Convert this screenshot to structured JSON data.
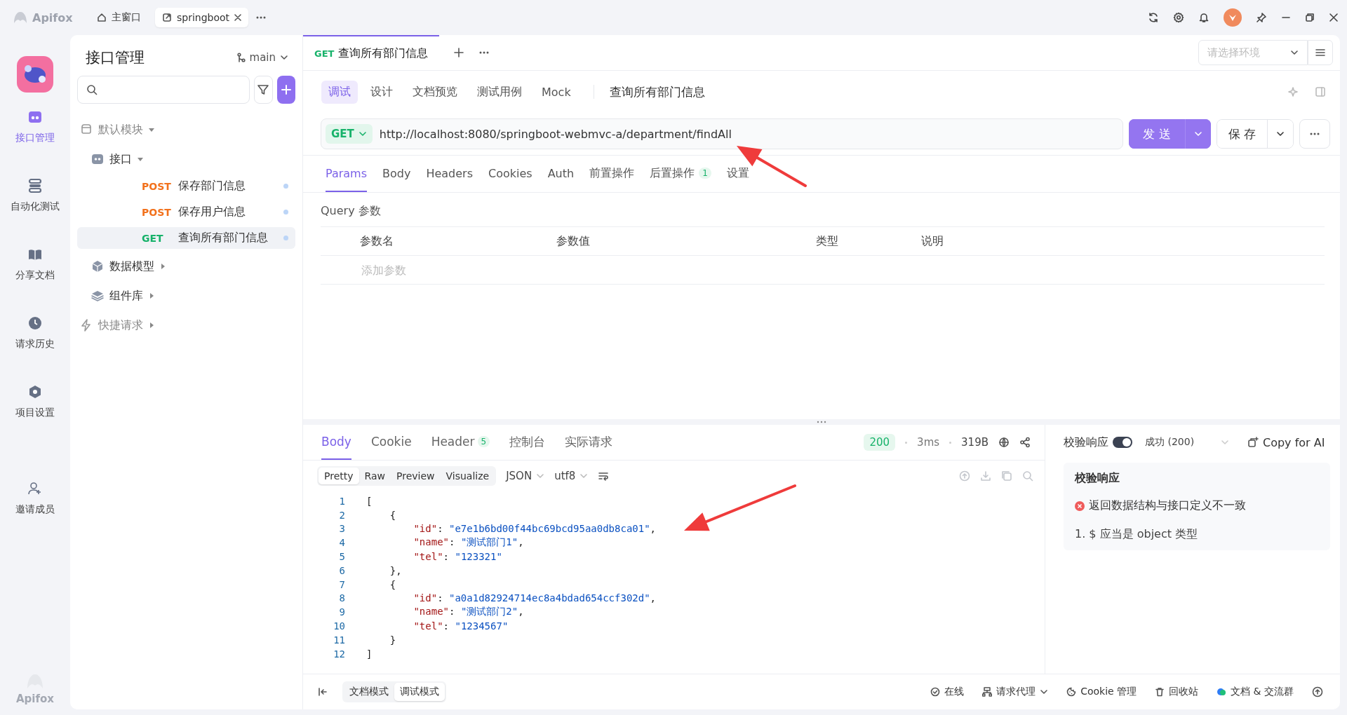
{
  "titlebar": {
    "app_name": "Apifox",
    "tabs": [
      {
        "label": "主窗口",
        "selected": false
      },
      {
        "label": "springboot",
        "selected": true
      }
    ]
  },
  "rail": {
    "items": [
      {
        "label": "接口管理",
        "selected": true
      },
      {
        "label": "自动化测试",
        "selected": false
      },
      {
        "label": "分享文档",
        "selected": false
      },
      {
        "label": "请求历史",
        "selected": false
      },
      {
        "label": "项目设置",
        "selected": false
      },
      {
        "label": "邀请成员",
        "selected": false
      }
    ],
    "footer_brand": "Apifox"
  },
  "tree_panel": {
    "title": "接口管理",
    "branch": "main",
    "items": [
      {
        "label": "默认模块",
        "kind": "module",
        "expanded": true,
        "children": [
          {
            "label": "接口",
            "kind": "folder",
            "expanded": true,
            "children": [
              {
                "kind": "endpoint",
                "method": "POST",
                "label": "保存部门信息",
                "selected": false
              },
              {
                "kind": "endpoint",
                "method": "POST",
                "label": "保存用户信息",
                "selected": false
              },
              {
                "kind": "endpoint",
                "method": "GET",
                "label": "查询所有部门信息",
                "selected": true
              }
            ]
          },
          {
            "label": "数据模型",
            "kind": "folder",
            "expanded": false
          },
          {
            "label": "组件库",
            "kind": "folder",
            "expanded": false
          }
        ]
      },
      {
        "label": "快捷请求",
        "kind": "module",
        "expanded": false
      }
    ]
  },
  "request_tab": {
    "method": "GET",
    "title": "查询所有部门信息",
    "env_placeholder": "请选择环境"
  },
  "mode_tabs": [
    {
      "label": "调试",
      "selected": true
    },
    {
      "label": "设计",
      "selected": false
    },
    {
      "label": "文档预览",
      "selected": false
    },
    {
      "label": "测试用例",
      "selected": false
    },
    {
      "label": "Mock",
      "selected": false
    }
  ],
  "api_name": "查询所有部门信息",
  "url_bar": {
    "method": "GET",
    "value": "http://localhost:8080/springboot-webmvc-a/department/findAll",
    "send": "发 送",
    "save": "保 存"
  },
  "param_tabs": [
    {
      "label": "Params",
      "selected": true
    },
    {
      "label": "Body",
      "selected": false
    },
    {
      "label": "Headers",
      "selected": false
    },
    {
      "label": "Cookies",
      "selected": false
    },
    {
      "label": "Auth",
      "selected": false
    },
    {
      "label": "前置操作",
      "selected": false
    },
    {
      "label": "后置操作",
      "selected": false,
      "badge": "1"
    },
    {
      "label": "设置",
      "selected": false
    }
  ],
  "query": {
    "title": "Query 参数",
    "columns": [
      "参数名",
      "参数值",
      "类型",
      "说明"
    ],
    "placeholder": "添加参数"
  },
  "response": {
    "tabs": [
      {
        "label": "Body",
        "selected": true
      },
      {
        "label": "Cookie",
        "selected": false
      },
      {
        "label": "Header",
        "selected": false,
        "badge": "5"
      },
      {
        "label": "控制台",
        "selected": false
      },
      {
        "label": "实际请求",
        "selected": false
      }
    ],
    "status": "200",
    "time": "3ms",
    "size": "319B",
    "view_tabs": [
      {
        "label": "Pretty",
        "selected": true
      },
      {
        "label": "Raw",
        "selected": false
      },
      {
        "label": "Preview",
        "selected": false
      },
      {
        "label": "Visualize",
        "selected": false
      }
    ],
    "format": "JSON",
    "encoding": "utf8",
    "lines": [
      {
        "number": "1",
        "text": "["
      },
      {
        "number": "2",
        "text": "    {"
      },
      {
        "number": "3",
        "text": "        \"id\": \"e7e1b6bd00f44bc69bcd95aa0db8ca01\","
      },
      {
        "number": "4",
        "text": "        \"name\": \"测试部门1\","
      },
      {
        "number": "5",
        "text": "        \"tel\": \"123321\""
      },
      {
        "number": "6",
        "text": "    },"
      },
      {
        "number": "7",
        "text": "    {"
      },
      {
        "number": "8",
        "text": "        \"id\": \"a0a1d82924714ec8a4bdad654ccf302d\","
      },
      {
        "number": "9",
        "text": "        \"name\": \"测试部门2\","
      },
      {
        "number": "10",
        "text": "        \"tel\": \"1234567\""
      },
      {
        "number": "11",
        "text": "    }"
      },
      {
        "number": "12",
        "text": "]"
      }
    ]
  },
  "validation": {
    "label": "校验响应",
    "on": true,
    "response": "成功 (200)",
    "copy": "Copy for AI",
    "title": "校验响应",
    "error": "返回数据结构与接口定义不一致",
    "detail": "1. $ 应当是 object 类型"
  },
  "bottom_bar": {
    "modes": [
      {
        "label": "文档模式",
        "selected": false
      },
      {
        "label": "调试模式",
        "selected": true
      }
    ],
    "items": [
      {
        "label": "在线"
      },
      {
        "label": "请求代理",
        "dropdown": true
      },
      {
        "label": "Cookie 管理"
      },
      {
        "label": "回收站"
      },
      {
        "label": "文档 & 交流群"
      }
    ]
  }
}
